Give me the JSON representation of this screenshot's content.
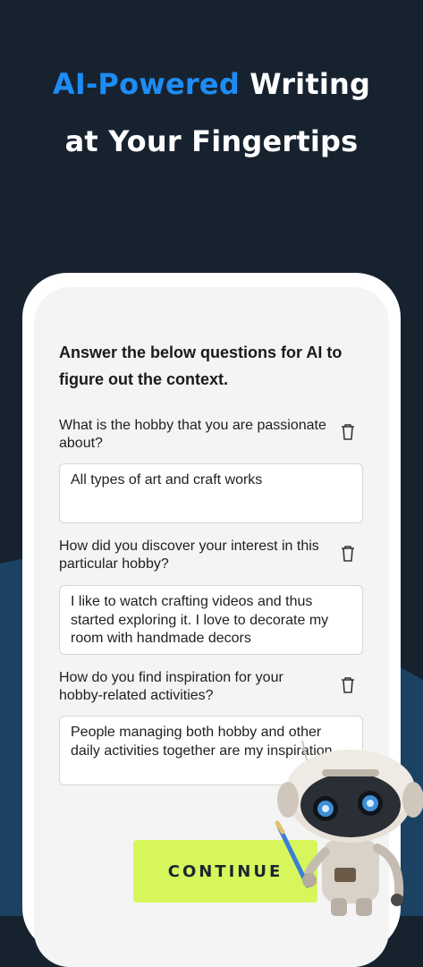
{
  "hero": {
    "accent": "AI-Powered",
    "line1_rest": " Writing",
    "line2": "at Your Fingertips"
  },
  "form": {
    "intro": "Answer the below questions for AI to figure out the context.",
    "items": [
      {
        "question": "What is the hobby that you are passionate about?",
        "answer": "All types of art and craft works"
      },
      {
        "question": "How did you discover your interest in this particular hobby?",
        "answer": "I like to watch crafting videos and thus started exploring it. I love to decorate my room with handmade decors"
      },
      {
        "question": "How do you find inspiration for your hobby-related activities?",
        "answer": "People managing both hobby and other daily activities together are my inspiration"
      }
    ],
    "continue_label": "CONTINUE"
  },
  "colors": {
    "background": "#17222f",
    "wave": "#1b4163",
    "accent_blue": "#1e8cf5",
    "button": "#d7f65c"
  },
  "icons": {
    "trash": "trash-icon",
    "mascot": "robot-mascot"
  }
}
